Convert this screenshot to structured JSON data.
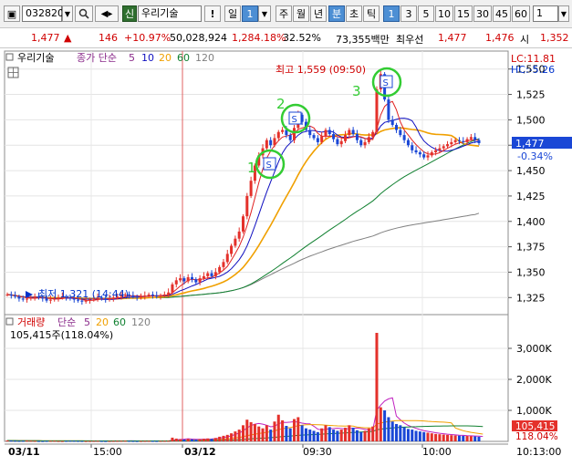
{
  "toolbar": {
    "code": "032820",
    "badge": "신",
    "stock_name": "우리기술",
    "warn": "!",
    "period_selected": "일",
    "period_num": "1",
    "periods": [
      "주",
      "월",
      "년"
    ],
    "intervals": [
      "분",
      "초",
      "틱"
    ],
    "minute_options": [
      "1",
      "3",
      "5",
      "10",
      "15",
      "30",
      "45",
      "60"
    ],
    "minute_selected": "1",
    "right_num": "1"
  },
  "quote": {
    "price": "1,477",
    "arrow": "▲",
    "change": "146",
    "change_pct": "+10.97%",
    "volume": "50,028,924",
    "volume_ratio": "1,284.18%",
    "turnover": "32.52%",
    "trade_value": "73,355백만",
    "best_label": "최우선",
    "ask": "1,477",
    "bid": "1,476",
    "open_label": "시",
    "open": "1,352"
  },
  "price_panel": {
    "stock": "우리기술",
    "legend_label": "종가 단순",
    "ma_periods": [
      "5",
      "10",
      "20",
      "60",
      "120"
    ],
    "lc": "LC:11.81",
    "hc": "HC:-5.26",
    "high_label": "최고 1,559 (09:50)",
    "low_label": "최저 1,321 (14:44)",
    "current_price": "1,477",
    "current_pct": "-0.34%",
    "signal_numbers": [
      "1",
      "2",
      "3"
    ],
    "signal_glyph": "S"
  },
  "volume_panel": {
    "legend_label": "거래량",
    "legend_ma": "단순",
    "ma_periods": [
      "5",
      "20",
      "60",
      "120"
    ],
    "summary": "105,415주(118.04%)",
    "current_volume": "105,415",
    "current_pct": "118.04%"
  },
  "time_axis": {
    "labels": [
      "03/11",
      "15:00",
      "03/12",
      "09:30",
      "10:00",
      "10:13:00"
    ]
  },
  "colors": {
    "up": "#e4312b",
    "down": "#1a47d6",
    "ma5": "#e02020",
    "ma10": "#1010c0",
    "ma20": "#f0a000",
    "ma60": "#108030",
    "ma120": "#808080",
    "signal_circle": "#33cc33"
  },
  "chart_data": [
    {
      "type": "line",
      "title": "우리기술 1분봉 (candlestick)",
      "ylabel": "",
      "ylim": [
        1310,
        1565
      ],
      "y_ticks": [
        1325,
        1350,
        1375,
        1400,
        1425,
        1450,
        1475,
        1500,
        1525,
        1550
      ],
      "x_ticks": [
        "03/11",
        "15:00",
        "03/12",
        "09:30",
        "10:00"
      ],
      "series": [
        {
          "name": "OHLC",
          "close": [
            1328,
            1327,
            1326,
            1324,
            1323,
            1324,
            1325,
            1326,
            1325,
            1324,
            1322,
            1323,
            1324,
            1325,
            1326,
            1325,
            1324,
            1323,
            1322,
            1321,
            1322,
            1323,
            1324,
            1325,
            1324,
            1323,
            1324,
            1325,
            1326,
            1327,
            1328,
            1327,
            1326,
            1325,
            1326,
            1327,
            1328,
            1327,
            1326,
            1327,
            1328,
            1330,
            1338,
            1342,
            1344,
            1341,
            1345,
            1343,
            1340,
            1344,
            1346,
            1349,
            1346,
            1350,
            1355,
            1360,
            1368,
            1376,
            1383,
            1390,
            1405,
            1425,
            1440,
            1455,
            1465,
            1472,
            1480,
            1475,
            1482,
            1488,
            1490,
            1485,
            1480,
            1492,
            1505,
            1498,
            1490,
            1485,
            1482,
            1478,
            1484,
            1490,
            1486,
            1481,
            1476,
            1479,
            1485,
            1490,
            1486,
            1480,
            1475,
            1478,
            1483,
            1488,
            1530,
            1545,
            1520,
            1500,
            1495,
            1490,
            1485,
            1480,
            1475,
            1470,
            1468,
            1466,
            1463,
            1465,
            1468,
            1470,
            1472,
            1474,
            1476,
            1478,
            1480,
            1479,
            1478,
            1481,
            1483,
            1480,
            1477
          ]
        },
        {
          "name": "5",
          "values": "moving average of close"
        },
        {
          "name": "10",
          "values": "moving average of close"
        },
        {
          "name": "20",
          "values": "moving average of close"
        },
        {
          "name": "60",
          "values": "moving average of close"
        },
        {
          "name": "120",
          "values": "moving average of close"
        }
      ]
    },
    {
      "type": "bar",
      "title": "거래량",
      "ylim": [
        0,
        3500
      ],
      "y_ticks_k": [
        1000,
        2000,
        3000
      ],
      "values_k": [
        30,
        25,
        20,
        15,
        18,
        22,
        20,
        15,
        12,
        10,
        14,
        16,
        18,
        12,
        10,
        15,
        20,
        18,
        14,
        12,
        10,
        12,
        14,
        16,
        12,
        10,
        12,
        14,
        16,
        18,
        20,
        15,
        12,
        10,
        12,
        14,
        16,
        14,
        12,
        14,
        16,
        18,
        120,
        90,
        70,
        60,
        80,
        65,
        55,
        70,
        85,
        95,
        80,
        110,
        150,
        180,
        210,
        260,
        320,
        380,
        520,
        700,
        620,
        560,
        480,
        420,
        520,
        380,
        640,
        860,
        680,
        500,
        420,
        720,
        780,
        520,
        420,
        380,
        340,
        300,
        420,
        520,
        460,
        380,
        340,
        380,
        440,
        520,
        440,
        360,
        300,
        340,
        420,
        480,
        3500,
        1100,
        1000,
        780,
        640,
        560,
        520,
        460,
        400,
        380,
        340,
        320,
        300,
        280,
        260,
        240,
        230,
        220,
        210,
        200,
        190,
        185,
        180,
        175,
        170,
        160,
        150,
        140
      ]
    }
  ]
}
